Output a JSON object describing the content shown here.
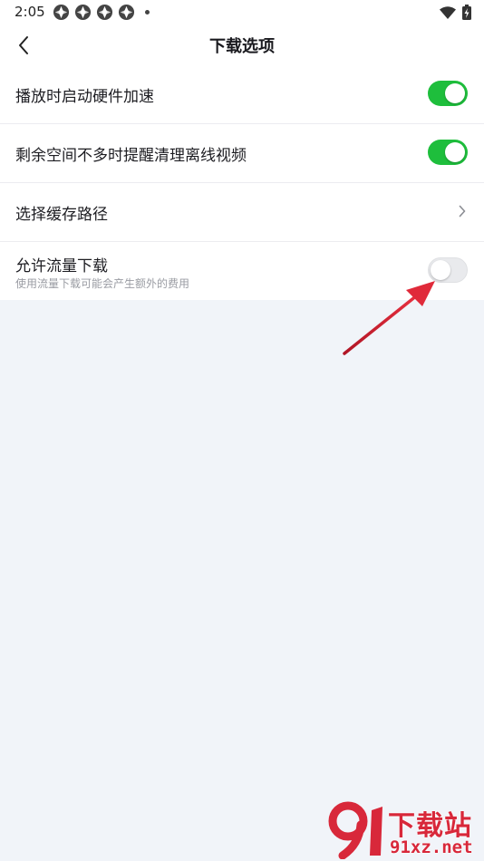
{
  "status_bar": {
    "time": "2:05",
    "notification_icons": [
      "app-icon",
      "app-icon",
      "app-icon",
      "app-icon"
    ]
  },
  "header": {
    "title": "下载选项",
    "back_icon": "chevron-left-icon"
  },
  "settings": [
    {
      "label": "播放时启动硬件加速",
      "control": "toggle",
      "state": "on"
    },
    {
      "label": "剩余空间不多时提醒清理离线视频",
      "control": "toggle",
      "state": "on"
    },
    {
      "label": "选择缓存路径",
      "control": "chevron"
    },
    {
      "label": "允许流量下载",
      "subtitle": "使用流量下载可能会产生额外的费用",
      "control": "toggle",
      "state": "off"
    }
  ],
  "colors": {
    "toggle_on": "#1ebe3c",
    "toggle_off": "#e9eaed",
    "background": "#f1f4f9",
    "annotation_arrow": "#d8283a"
  },
  "watermark": {
    "text": "下载站",
    "url": "91xz.net"
  }
}
